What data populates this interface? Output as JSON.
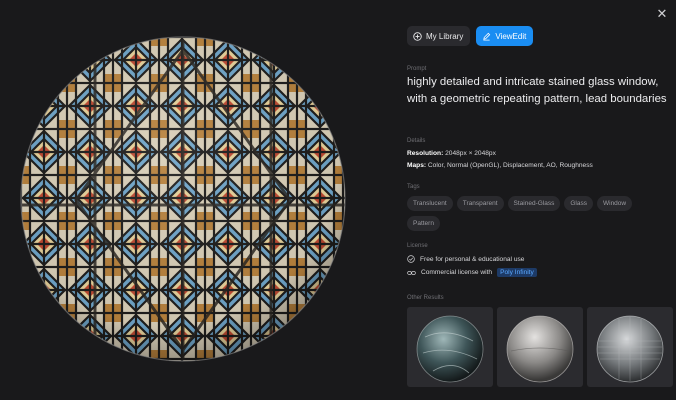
{
  "header": {
    "close_icon": "close-icon",
    "my_library_label": "My Library",
    "view_edit_label": "ViewEdit"
  },
  "prompt": {
    "label": "Prompt",
    "text": "highly detailed and intricate stained glass window, with a geometric repeating pattern, lead boundaries"
  },
  "details": {
    "label": "Details",
    "resolution_key": "Resolution:",
    "resolution_value": "2048px × 2048px",
    "maps_key": "Maps:",
    "maps_value": "Color, Normal (OpenGL), Displacement, AO, Roughness"
  },
  "tags": {
    "label": "Tags",
    "items": [
      "Translucent",
      "Transparent",
      "Stained-Glass",
      "Glass",
      "Window",
      "Pattern"
    ]
  },
  "license": {
    "label": "License",
    "personal": "Free for personal & educational use",
    "commercial": "Commercial license with",
    "commercial_link": "Poly Infinity"
  },
  "other_results": {
    "label": "Other Results",
    "items": [
      {
        "name": "dark teal glass sphere"
      },
      {
        "name": "frosted grey glass sphere"
      },
      {
        "name": "clear glass sphere"
      }
    ]
  },
  "colors": {
    "background": "#19191b",
    "accent": "#1a8df2",
    "tag_bg": "#2a2a2e"
  }
}
